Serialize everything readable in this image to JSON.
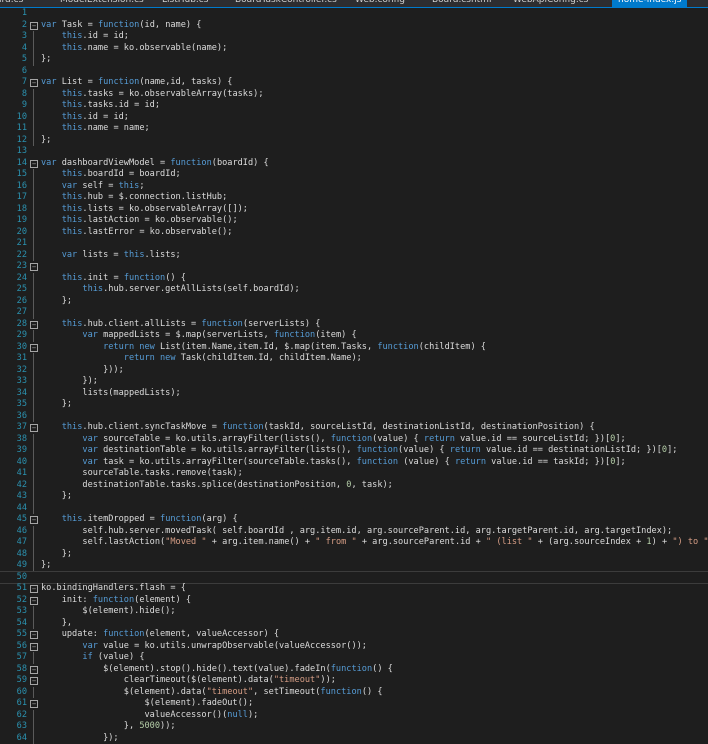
{
  "tabs": [
    {
      "label": "ard.cs",
      "active": false
    },
    {
      "label": "ModelExtension.cs",
      "active": false
    },
    {
      "label": "ListHub.cs",
      "active": false
    },
    {
      "label": "BoardTaskController.cs",
      "active": false
    },
    {
      "label": "Web.config",
      "active": false
    },
    {
      "label": "Board.cshtml",
      "active": false
    },
    {
      "label": "WebApiConfig.cs",
      "active": false
    },
    {
      "label": "home-index.js",
      "active": true
    }
  ],
  "fold_markers": [
    2,
    7,
    14,
    23,
    28,
    30,
    37,
    45,
    51,
    52,
    55,
    56,
    58,
    59,
    61
  ],
  "gutter_lines": [
    3,
    4,
    5,
    8,
    9,
    10,
    11,
    12,
    15,
    16,
    17,
    18,
    19,
    20,
    21,
    22,
    24,
    25,
    26,
    27,
    29,
    31,
    32,
    33,
    34,
    35,
    36,
    38,
    39,
    40,
    41,
    42,
    43,
    44,
    46,
    47,
    48,
    49,
    53,
    54,
    57,
    60,
    62,
    63,
    64,
    65,
    66
  ],
  "current_line": 50,
  "lines": [
    {
      "n": "1",
      "t": []
    },
    {
      "n": "2",
      "t": [
        [
          "k",
          "var"
        ],
        [
          "p",
          " Task = "
        ],
        [
          "k",
          "function"
        ],
        [
          "p",
          "(id, name) {"
        ]
      ]
    },
    {
      "n": "3",
      "t": [
        [
          "k",
          "    this"
        ],
        [
          "p",
          ".id = id;"
        ]
      ]
    },
    {
      "n": "4",
      "t": [
        [
          "k",
          "    this"
        ],
        [
          "p",
          ".name = ko.observable(name);"
        ]
      ]
    },
    {
      "n": "5",
      "t": [
        [
          "p",
          "};"
        ]
      ]
    },
    {
      "n": "6",
      "t": []
    },
    {
      "n": "7",
      "t": [
        [
          "k",
          "var"
        ],
        [
          "p",
          " List = "
        ],
        [
          "k",
          "function"
        ],
        [
          "p",
          "(name,id, tasks) {"
        ]
      ]
    },
    {
      "n": "8",
      "t": [
        [
          "k",
          "    this"
        ],
        [
          "p",
          ".tasks = ko.observableArray(tasks);"
        ]
      ]
    },
    {
      "n": "9",
      "t": [
        [
          "k",
          "    this"
        ],
        [
          "p",
          ".tasks.id = id;"
        ]
      ]
    },
    {
      "n": "10",
      "t": [
        [
          "k",
          "    this"
        ],
        [
          "p",
          ".id = id;"
        ]
      ]
    },
    {
      "n": "11",
      "t": [
        [
          "k",
          "    this"
        ],
        [
          "p",
          ".name = name;"
        ]
      ]
    },
    {
      "n": "12",
      "t": [
        [
          "p",
          "};"
        ]
      ]
    },
    {
      "n": "13",
      "t": []
    },
    {
      "n": "14",
      "t": [
        [
          "k",
          "var"
        ],
        [
          "p",
          " dashboardViewModel = "
        ],
        [
          "k",
          "function"
        ],
        [
          "p",
          "(boardId) {"
        ]
      ]
    },
    {
      "n": "15",
      "t": [
        [
          "k",
          "    this"
        ],
        [
          "p",
          ".boardId = boardId;"
        ]
      ]
    },
    {
      "n": "16",
      "t": [
        [
          "k",
          "    var"
        ],
        [
          "p",
          " self = "
        ],
        [
          "k",
          "this"
        ],
        [
          "p",
          ";"
        ]
      ]
    },
    {
      "n": "17",
      "t": [
        [
          "k",
          "    this"
        ],
        [
          "p",
          ".hub = $.connection.listHub;"
        ]
      ]
    },
    {
      "n": "18",
      "t": [
        [
          "k",
          "    this"
        ],
        [
          "p",
          ".lists = ko.observableArray([]);"
        ]
      ]
    },
    {
      "n": "19",
      "t": [
        [
          "k",
          "    this"
        ],
        [
          "p",
          ".lastAction = ko.observable();"
        ]
      ]
    },
    {
      "n": "20",
      "t": [
        [
          "k",
          "    this"
        ],
        [
          "p",
          ".lastError = ko.observable();"
        ]
      ]
    },
    {
      "n": "21",
      "t": []
    },
    {
      "n": "22",
      "t": [
        [
          "k",
          "    var"
        ],
        [
          "p",
          " lists = "
        ],
        [
          "k",
          "this"
        ],
        [
          "p",
          ".lists;"
        ]
      ]
    },
    {
      "n": "23",
      "t": []
    },
    {
      "n": "24",
      "t": [
        [
          "k",
          "    this"
        ],
        [
          "p",
          ".init = "
        ],
        [
          "k",
          "function"
        ],
        [
          "p",
          "() {"
        ]
      ]
    },
    {
      "n": "25",
      "t": [
        [
          "k",
          "        this"
        ],
        [
          "p",
          ".hub.server.getAllLists(self.boardId);"
        ]
      ]
    },
    {
      "n": "26",
      "t": [
        [
          "p",
          "    };"
        ]
      ]
    },
    {
      "n": "27",
      "t": []
    },
    {
      "n": "28",
      "t": [
        [
          "k",
          "    this"
        ],
        [
          "p",
          ".hub.client.allLists = "
        ],
        [
          "k",
          "function"
        ],
        [
          "p",
          "(serverLists) {"
        ]
      ]
    },
    {
      "n": "29",
      "t": [
        [
          "k",
          "        var"
        ],
        [
          "p",
          " mappedLists = $.map(serverLists, "
        ],
        [
          "k",
          "function"
        ],
        [
          "p",
          "(item) {"
        ]
      ]
    },
    {
      "n": "30",
      "t": [
        [
          "k",
          "            return new"
        ],
        [
          "p",
          " List(item.Name,item.Id, $.map(item.Tasks, "
        ],
        [
          "k",
          "function"
        ],
        [
          "p",
          "(childItem) {"
        ]
      ]
    },
    {
      "n": "31",
      "t": [
        [
          "k",
          "                return new"
        ],
        [
          "p",
          " Task(childItem.Id, childItem.Name);"
        ]
      ]
    },
    {
      "n": "32",
      "t": [
        [
          "p",
          "            }));"
        ]
      ]
    },
    {
      "n": "33",
      "t": [
        [
          "p",
          "        });"
        ]
      ]
    },
    {
      "n": "34",
      "t": [
        [
          "p",
          "        lists(mappedLists);"
        ]
      ]
    },
    {
      "n": "35",
      "t": [
        [
          "p",
          "    };"
        ]
      ]
    },
    {
      "n": "36",
      "t": []
    },
    {
      "n": "37",
      "t": [
        [
          "k",
          "    this"
        ],
        [
          "p",
          ".hub.client.syncTaskMove = "
        ],
        [
          "k",
          "function"
        ],
        [
          "p",
          "(taskId, sourceListId, destinationListId, destinationPosition) {"
        ]
      ]
    },
    {
      "n": "38",
      "t": [
        [
          "k",
          "        var"
        ],
        [
          "p",
          " sourceTable = ko.utils.arrayFilter(lists(), "
        ],
        [
          "k",
          "function"
        ],
        [
          "p",
          "(value) { "
        ],
        [
          "k",
          "return"
        ],
        [
          "p",
          " value.id == sourceListId; })["
        ],
        [
          "n",
          "0"
        ],
        [
          "p",
          "];"
        ]
      ]
    },
    {
      "n": "39",
      "t": [
        [
          "k",
          "        var"
        ],
        [
          "p",
          " destinationTable = ko.utils.arrayFilter(lists(), "
        ],
        [
          "k",
          "function"
        ],
        [
          "p",
          "(value) { "
        ],
        [
          "k",
          "return"
        ],
        [
          "p",
          " value.id == destinationListId; })["
        ],
        [
          "n",
          "0"
        ],
        [
          "p",
          "];"
        ]
      ]
    },
    {
      "n": "40",
      "t": [
        [
          "k",
          "        var"
        ],
        [
          "p",
          " task = ko.utils.arrayFilter(sourceTable.tasks(), "
        ],
        [
          "k",
          "function"
        ],
        [
          "p",
          " (value) { "
        ],
        [
          "k",
          "return"
        ],
        [
          "p",
          " value.id == taskId; })["
        ],
        [
          "n",
          "0"
        ],
        [
          "p",
          "];"
        ]
      ]
    },
    {
      "n": "41",
      "t": [
        [
          "p",
          "        sourceTable.tasks.remove(task);"
        ]
      ]
    },
    {
      "n": "42",
      "t": [
        [
          "p",
          "        destinationTable.tasks.splice(destinationPosition, "
        ],
        [
          "n",
          "0"
        ],
        [
          "p",
          ", task);"
        ]
      ]
    },
    {
      "n": "43",
      "t": [
        [
          "p",
          "    };"
        ]
      ]
    },
    {
      "n": "44",
      "t": []
    },
    {
      "n": "45",
      "t": [
        [
          "k",
          "    this"
        ],
        [
          "p",
          ".itemDropped = "
        ],
        [
          "k",
          "function"
        ],
        [
          "p",
          "(arg) {"
        ]
      ]
    },
    {
      "n": "46",
      "t": [
        [
          "p",
          "        self.hub.server.movedTask( self.boardId , arg.item.id, arg.sourceParent.id, arg.targetParent.id, arg.targetIndex);"
        ]
      ]
    },
    {
      "n": "47",
      "t": [
        [
          "p",
          "        self.lastAction("
        ],
        [
          "s",
          "\"Moved \""
        ],
        [
          "p",
          " + arg.item.name() + "
        ],
        [
          "s",
          "\" from \""
        ],
        [
          "p",
          " + arg.sourceParent.id + "
        ],
        [
          "s",
          "\" (list \""
        ],
        [
          "p",
          " + (arg.sourceIndex + "
        ],
        [
          "n",
          "1"
        ],
        [
          "p",
          ") + "
        ],
        [
          "s",
          "\") to \""
        ]
      ]
    },
    {
      "n": "48",
      "t": [
        [
          "p",
          "    };"
        ]
      ]
    },
    {
      "n": "49",
      "t": [
        [
          "p",
          "};"
        ]
      ]
    },
    {
      "n": "50",
      "t": []
    },
    {
      "n": "51",
      "t": [
        [
          "p",
          "ko.bindingHandlers.flash = {"
        ]
      ]
    },
    {
      "n": "52",
      "t": [
        [
          "p",
          "    init: "
        ],
        [
          "k",
          "function"
        ],
        [
          "p",
          "(element) {"
        ]
      ]
    },
    {
      "n": "53",
      "t": [
        [
          "p",
          "        $(element).hide();"
        ]
      ]
    },
    {
      "n": "54",
      "t": [
        [
          "p",
          "    },"
        ]
      ]
    },
    {
      "n": "55",
      "t": [
        [
          "p",
          "    update: "
        ],
        [
          "k",
          "function"
        ],
        [
          "p",
          "(element, valueAccessor) {"
        ]
      ]
    },
    {
      "n": "56",
      "t": [
        [
          "k",
          "        var"
        ],
        [
          "p",
          " value = ko.utils.unwrapObservable(valueAccessor());"
        ]
      ]
    },
    {
      "n": "57",
      "t": [
        [
          "k",
          "        if"
        ],
        [
          "p",
          " (value) {"
        ]
      ]
    },
    {
      "n": "58",
      "t": [
        [
          "p",
          "            $(element).stop().hide().text(value).fadeIn("
        ],
        [
          "k",
          "function"
        ],
        [
          "p",
          "() {"
        ]
      ]
    },
    {
      "n": "59",
      "t": [
        [
          "p",
          "                clearTimeout($(element).data("
        ],
        [
          "s",
          "\"timeout\""
        ],
        [
          "p",
          "));"
        ]
      ]
    },
    {
      "n": "60",
      "t": [
        [
          "p",
          "                $(element).data("
        ],
        [
          "s",
          "\"timeout\""
        ],
        [
          "p",
          ", setTimeout("
        ],
        [
          "k",
          "function"
        ],
        [
          "p",
          "() {"
        ]
      ]
    },
    {
      "n": "61",
      "t": [
        [
          "p",
          "                    $(element).fadeOut();"
        ]
      ]
    },
    {
      "n": "62",
      "t": [
        [
          "p",
          "                    valueAccessor()("
        ],
        [
          "k",
          "null"
        ],
        [
          "p",
          ");"
        ]
      ]
    },
    {
      "n": "63",
      "t": [
        [
          "p",
          "                }, "
        ],
        [
          "n",
          "5000"
        ],
        [
          "p",
          "));"
        ]
      ]
    },
    {
      "n": "64",
      "t": [
        [
          "p",
          "            });"
        ]
      ]
    },
    {
      "n": "65",
      "t": [
        [
          "p",
          "        }"
        ]
      ]
    }
  ]
}
